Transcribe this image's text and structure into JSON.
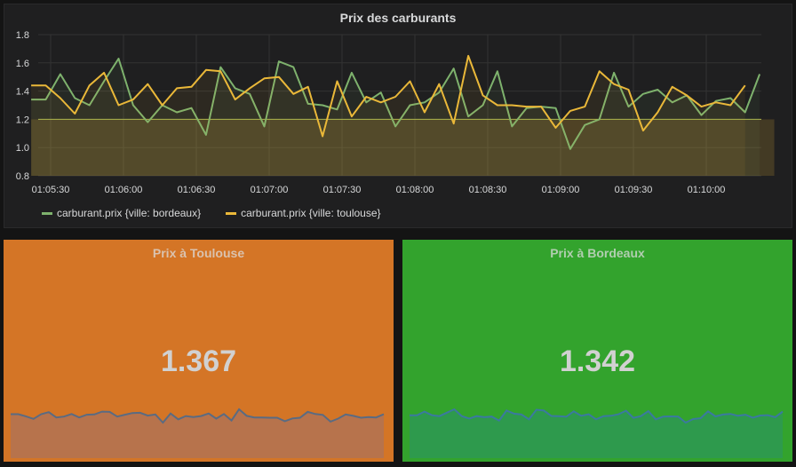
{
  "graph": {
    "title": "Prix des carburants",
    "legend": [
      {
        "label": "carburant.prix {ville: bordeaux}",
        "color": "#7eb26d"
      },
      {
        "label": "carburant.prix {ville: toulouse}",
        "color": "#eab839"
      }
    ]
  },
  "stats": {
    "toulouse": {
      "title": "Prix à Toulouse",
      "value": "1.367",
      "bg": "#d47526",
      "spark_fill": "#b7734c",
      "spark_line": "#5a6b82"
    },
    "bordeaux": {
      "title": "Prix à Bordeaux",
      "value": "1.342",
      "bg": "#33a32d",
      "spark_fill": "#2e9a4d",
      "spark_line": "#3b79a0"
    }
  },
  "chart_data": {
    "type": "line",
    "x": [
      "01:05:22",
      "01:05:28",
      "01:05:34",
      "01:05:40",
      "01:05:46",
      "01:05:52",
      "01:05:58",
      "01:06:04",
      "01:06:10",
      "01:06:16",
      "01:06:22",
      "01:06:28",
      "01:06:34",
      "01:06:40",
      "01:06:46",
      "01:06:52",
      "01:06:58",
      "01:07:04",
      "01:07:10",
      "01:07:16",
      "01:07:22",
      "01:07:28",
      "01:07:34",
      "01:07:40",
      "01:07:46",
      "01:07:52",
      "01:07:58",
      "01:08:04",
      "01:08:10",
      "01:08:16",
      "01:08:22",
      "01:08:28",
      "01:08:34",
      "01:08:40",
      "01:08:46",
      "01:08:52",
      "01:08:58",
      "01:09:04",
      "01:09:10",
      "01:09:16",
      "01:09:22",
      "01:09:28",
      "01:09:34",
      "01:09:40",
      "01:09:46",
      "01:09:52",
      "01:09:58",
      "01:10:04",
      "01:10:10",
      "01:10:16",
      "01:10:22",
      "01:10:28"
    ],
    "series": [
      {
        "name": "carburant.prix {ville: bordeaux}",
        "color": "#7eb26d",
        "values": [
          1.34,
          1.34,
          1.52,
          1.35,
          1.3,
          1.47,
          1.63,
          1.3,
          1.18,
          1.3,
          1.25,
          1.28,
          1.09,
          1.57,
          1.42,
          1.38,
          1.15,
          1.61,
          1.57,
          1.31,
          1.3,
          1.27,
          1.53,
          1.32,
          1.39,
          1.15,
          1.3,
          1.32,
          1.39,
          1.56,
          1.22,
          1.3,
          1.54,
          1.15,
          1.28,
          1.29,
          1.28,
          0.99,
          1.16,
          1.2,
          1.53,
          1.29,
          1.38,
          1.41,
          1.32,
          1.37,
          1.23,
          1.33,
          1.35,
          1.25,
          1.52
        ]
      },
      {
        "name": "carburant.prix {ville: toulouse}",
        "color": "#eab839",
        "values": [
          1.44,
          1.44,
          1.35,
          1.24,
          1.44,
          1.53,
          1.3,
          1.34,
          1.45,
          1.3,
          1.42,
          1.43,
          1.55,
          1.54,
          1.34,
          1.42,
          1.49,
          1.5,
          1.38,
          1.43,
          1.08,
          1.47,
          1.22,
          1.36,
          1.32,
          1.36,
          1.47,
          1.25,
          1.45,
          1.17,
          1.65,
          1.37,
          1.3,
          1.3,
          1.29,
          1.29,
          1.14,
          1.26,
          1.29,
          1.54,
          1.45,
          1.41,
          1.12,
          1.25,
          1.43,
          1.37,
          1.29,
          1.32,
          1.3,
          1.44
        ]
      }
    ],
    "threshold": 1.2,
    "ylim": [
      0.8,
      1.8
    ],
    "yticks": [
      "0.8",
      "1.0",
      "1.2",
      "1.4",
      "1.6",
      "1.8"
    ],
    "xticks": [
      "01:05:30",
      "01:06:00",
      "01:06:30",
      "01:07:00",
      "01:07:30",
      "01:08:00",
      "01:08:30",
      "01:09:00",
      "01:09:30",
      "01:10:00"
    ],
    "grid": true,
    "legend_position": "bottom-left"
  }
}
